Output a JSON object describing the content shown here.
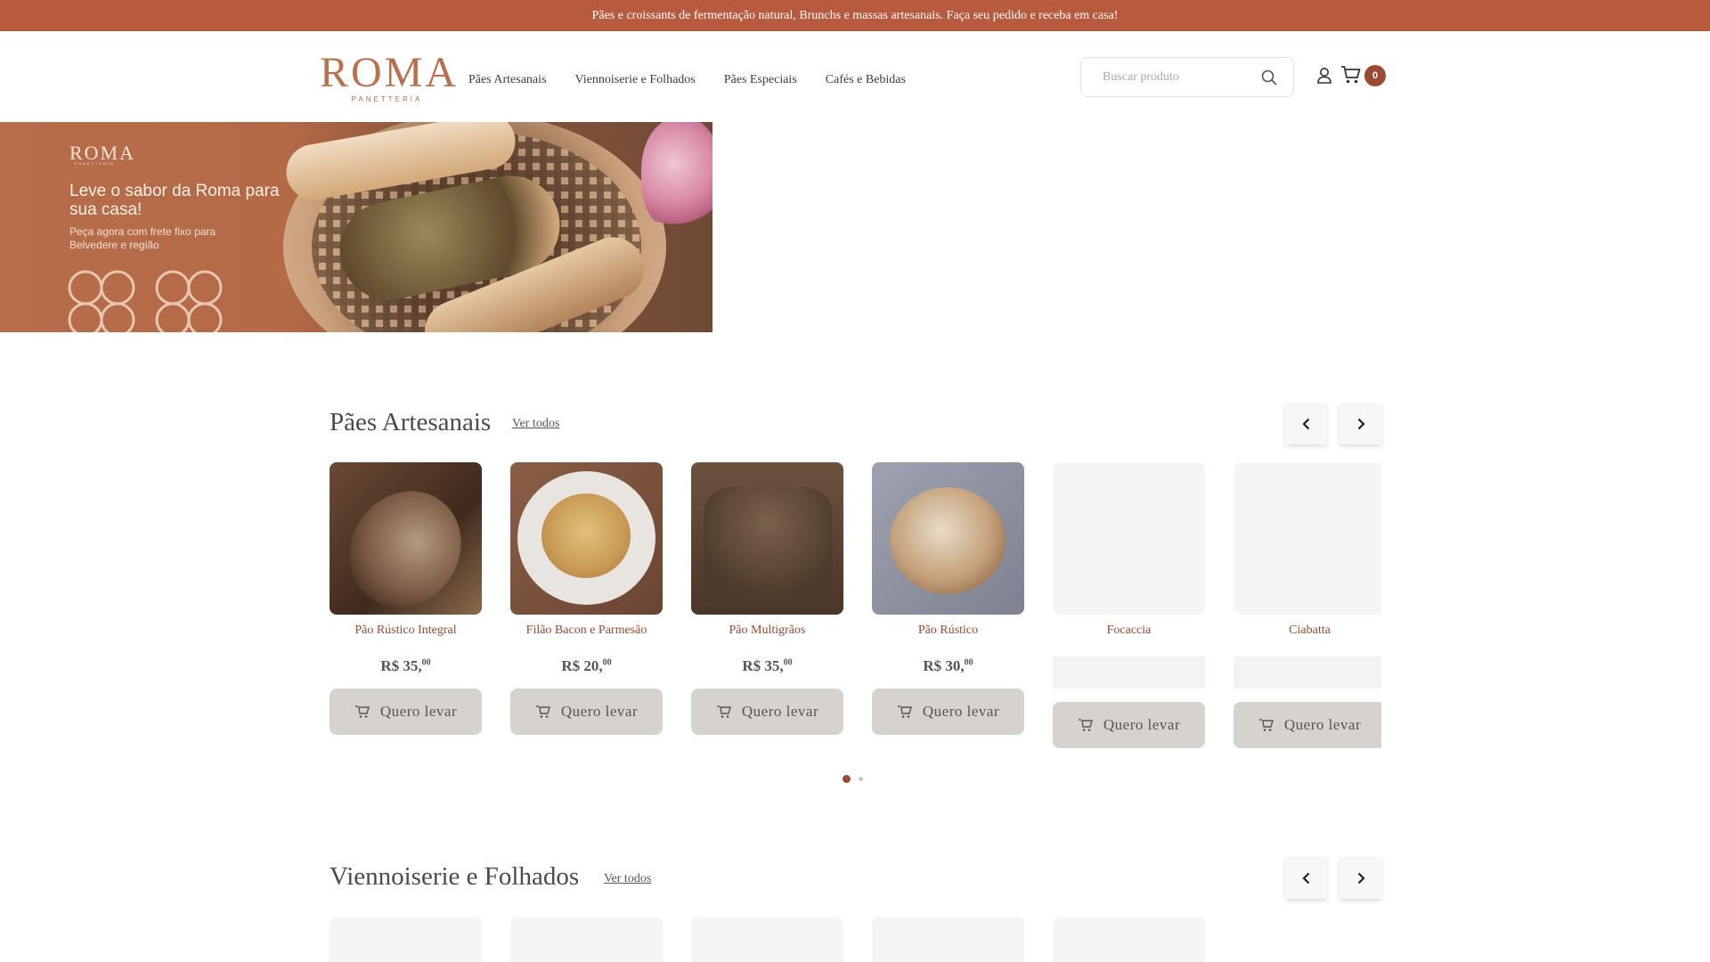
{
  "announcement": "Pães e croissants de fermentação natural, Brunchs e massas artesanais. Faça seu pedido e receba em casa!",
  "brand": {
    "name": "ROMA",
    "sub": "PANETTERIA",
    "color": "#b8704f"
  },
  "nav": [
    "Pães Artesanais",
    "Viennoiserie e Folhados",
    "Pães Especiais",
    "Cafés e Bebidas"
  ],
  "search": {
    "placeholder": "Buscar produto"
  },
  "cart": {
    "count": "0"
  },
  "banner": {
    "logo": "ROMA",
    "logo_sub": "PANETTERIA",
    "headline": "Leve o sabor da Roma para sua casa!",
    "subtext": "Peça agora com frete fixo para Belvedere e região"
  },
  "sections": [
    {
      "title": "Pães Artesanais",
      "link": "Ver todos",
      "products": [
        {
          "name": "Pão Rústico Integral",
          "price_main": "R$ 35,",
          "price_cents": "00",
          "button": "Quero levar",
          "loaded": true
        },
        {
          "name": "Filão Bacon e Parmesão",
          "price_main": "R$ 20,",
          "price_cents": "00",
          "button": "Quero levar",
          "loaded": true
        },
        {
          "name": "Pão Multigrãos",
          "price_main": "R$ 35,",
          "price_cents": "00",
          "button": "Quero levar",
          "loaded": true
        },
        {
          "name": "Pão Rústico",
          "price_main": "R$ 30,",
          "price_cents": "00",
          "button": "Quero levar",
          "loaded": true
        },
        {
          "name": "Focaccia",
          "price_main": "",
          "price_cents": "",
          "button": "Quero levar",
          "loaded": false
        },
        {
          "name": "Ciabatta",
          "price_main": "",
          "price_cents": "",
          "button": "Quero levar",
          "loaded": false
        }
      ],
      "pagination": {
        "pages": 2,
        "current": 1
      }
    },
    {
      "title": "Viennoiserie e Folhados",
      "link": "Ver todos"
    }
  ],
  "colors": {
    "topbar": "#b85a3e",
    "accent": "#9a4a30",
    "button_bg": "#d6d2ce"
  }
}
